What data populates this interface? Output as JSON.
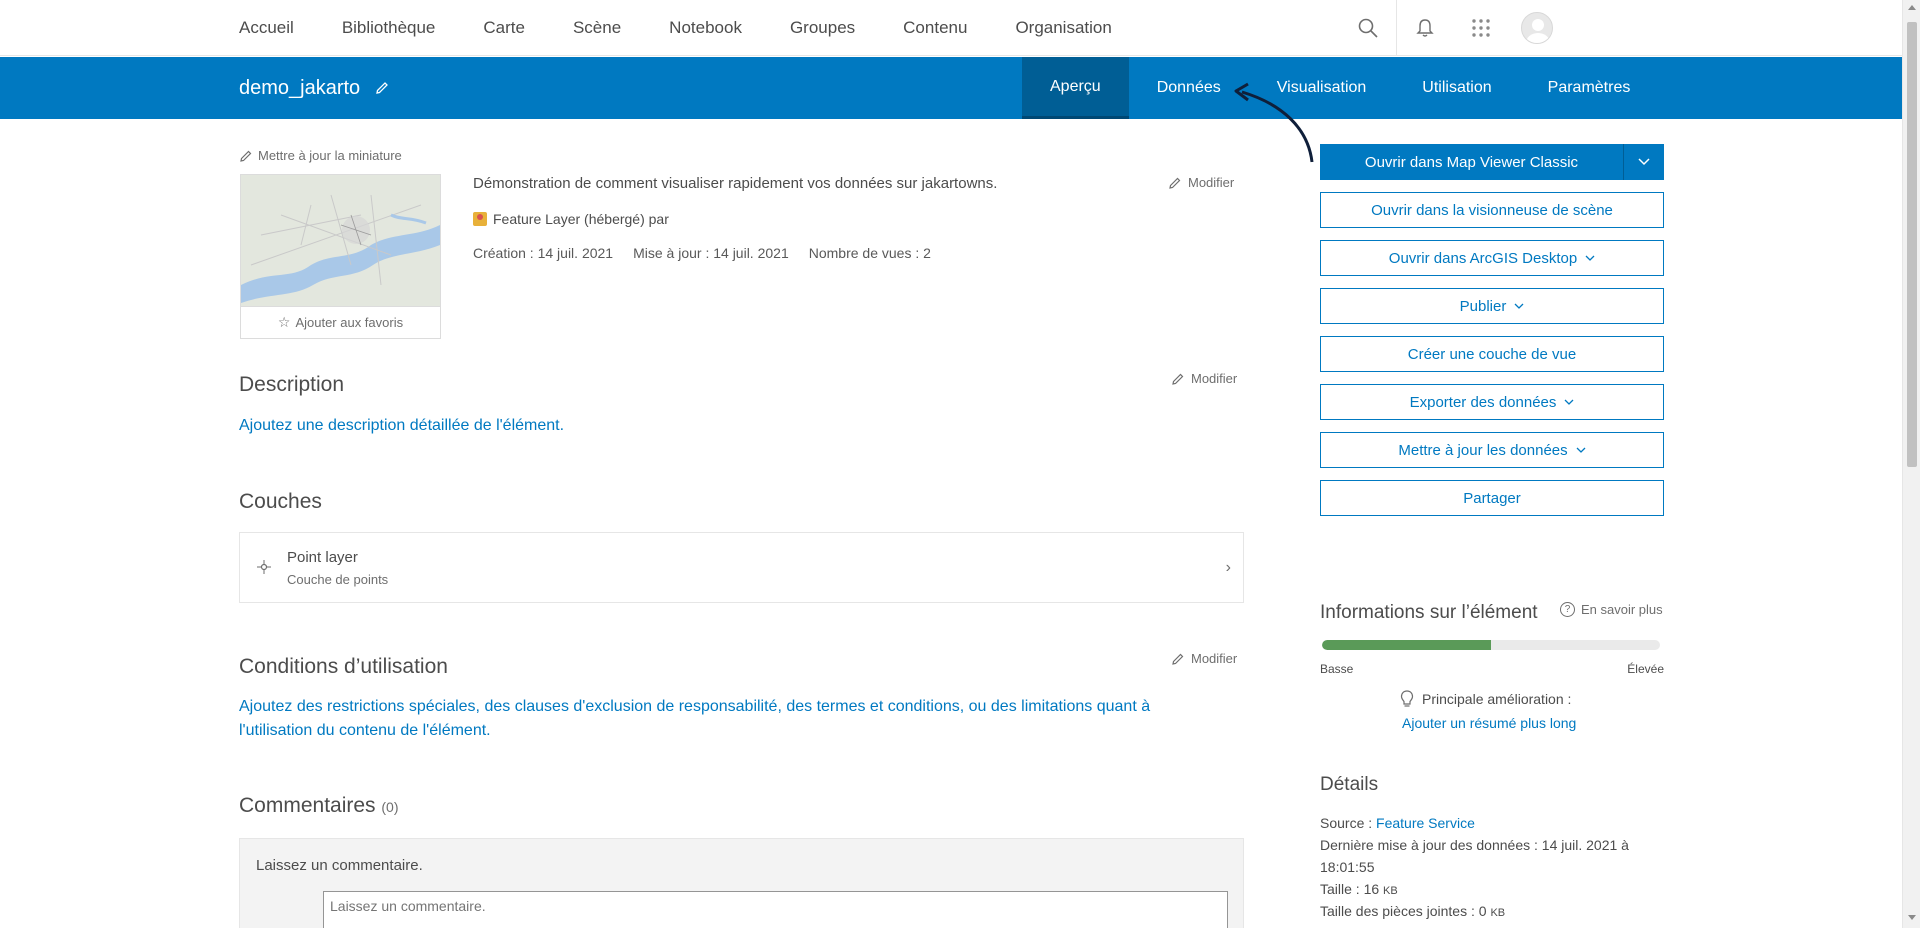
{
  "topnav": {
    "links": [
      "Accueil",
      "Bibliothèque",
      "Carte",
      "Scène",
      "Notebook",
      "Groupes",
      "Contenu",
      "Organisation"
    ]
  },
  "header": {
    "title": "demo_jakarto",
    "tabs": [
      "Aperçu",
      "Données",
      "Visualisation",
      "Utilisation",
      "Paramètres"
    ],
    "active_tab": "Aperçu",
    "accent_color": "#0079c1"
  },
  "overview": {
    "update_thumbnail": "Mettre à jour la miniature",
    "add_favorite": "Ajouter aux favoris",
    "summary": "Démonstration de comment visualiser rapidement vos données sur jakartowns.",
    "type_line": "Feature Layer (hébergé) par",
    "created": "Création : 14 juil. 2021",
    "updated": "Mise à jour : 14 juil. 2021",
    "views": "Nombre de vues : 2",
    "edit_label": "Modifier"
  },
  "description": {
    "title": "Description",
    "placeholder": "Ajoutez une description détaillée de l'élément.",
    "edit_label": "Modifier"
  },
  "layers": {
    "title": "Couches",
    "items": [
      {
        "name": "Point layer",
        "type": "Couche de points"
      }
    ]
  },
  "terms": {
    "title": "Conditions d’utilisation",
    "edit_label": "Modifier",
    "line1": "Ajoutez des restrictions spéciales, des clauses d'exclusion de responsabilité, des termes et conditions, ou des limitations quant à",
    "line2": "l'utilisation du contenu de l'élément."
  },
  "comments": {
    "title": "Commentaires",
    "count": "(0)",
    "prompt": "Laissez un commentaire.",
    "placeholder": "Laissez un commentaire."
  },
  "actions": {
    "primary": "Ouvrir dans Map Viewer Classic",
    "buttons": [
      {
        "label": "Ouvrir dans la visionneuse de scène",
        "dropdown": false
      },
      {
        "label": "Ouvrir dans ArcGIS Desktop",
        "dropdown": true
      },
      {
        "label": "Publier",
        "dropdown": true
      },
      {
        "label": "Créer une couche de vue",
        "dropdown": false
      },
      {
        "label": "Exporter des données",
        "dropdown": true
      },
      {
        "label": "Mettre à jour les données",
        "dropdown": true
      },
      {
        "label": "Partager",
        "dropdown": false
      }
    ]
  },
  "item_info": {
    "title": "Informations sur l’élément",
    "learn_more": "En savoir plus",
    "score_fraction": 0.5,
    "low": "Basse",
    "high": "Élevée",
    "tip_label": "Principale amélioration :",
    "tip_link": "Ajouter un résumé plus long",
    "meter_color": "#5a9a58"
  },
  "details": {
    "title": "Détails",
    "source_label": "Source :",
    "source_value": "Feature Service",
    "last_update_label": "Dernière mise à jour des données : 14 juil. 2021 à",
    "last_update_time": "18:01:55",
    "size_label": "Taille : 16",
    "size_unit": "KB",
    "attachments_label": "Taille des pièces jointes : 0",
    "attachments_unit": "KB"
  }
}
